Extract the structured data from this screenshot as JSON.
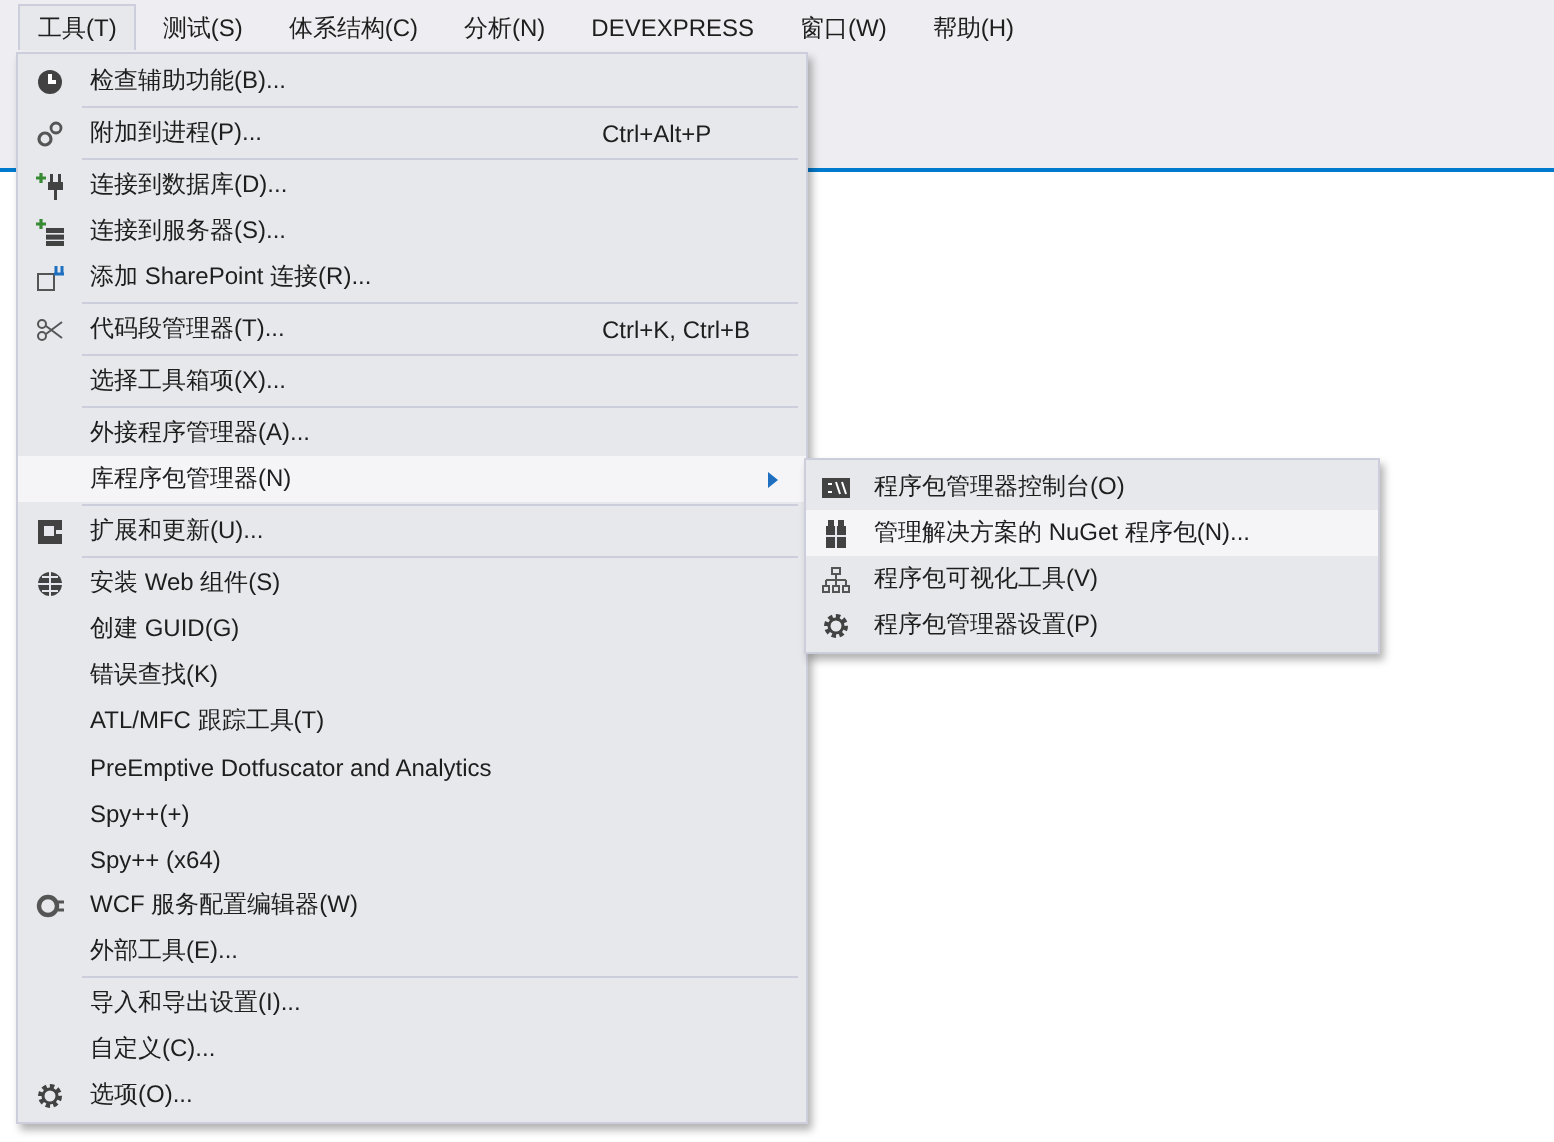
{
  "menu_bar": [
    {
      "label": "工具(T)",
      "selected": true
    },
    {
      "label": "测试(S)",
      "selected": false
    },
    {
      "label": "体系结构(C)",
      "selected": false
    },
    {
      "label": "分析(N)",
      "selected": false
    },
    {
      "label": "DEVEXPRESS",
      "selected": false
    },
    {
      "label": "窗口(W)",
      "selected": false
    },
    {
      "label": "帮助(H)",
      "selected": false
    }
  ],
  "tools_menu": {
    "groups": [
      [
        {
          "label": "检查辅助功能(B)...",
          "selected": false,
          "has_submenu": false
        }
      ],
      [
        {
          "label": "附加到进程(P)...",
          "shortcut": "Ctrl+Alt+P",
          "selected": false,
          "has_submenu": false
        }
      ],
      [
        {
          "label": "连接到数据库(D)...",
          "selected": false,
          "has_submenu": false
        },
        {
          "label": "连接到服务器(S)...",
          "selected": false,
          "has_submenu": false
        },
        {
          "label": "添加 SharePoint 连接(R)...",
          "selected": false,
          "has_submenu": false
        }
      ],
      [
        {
          "label": "代码段管理器(T)...",
          "shortcut": "Ctrl+K, Ctrl+B",
          "selected": false,
          "has_submenu": false
        }
      ],
      [
        {
          "label": "选择工具箱项(X)...",
          "selected": false,
          "has_submenu": false
        }
      ],
      [
        {
          "label": "外接程序管理器(A)...",
          "selected": false,
          "has_submenu": false
        },
        {
          "label": "库程序包管理器(N)",
          "selected": true,
          "has_submenu": true
        }
      ],
      [
        {
          "label": "扩展和更新(U)...",
          "selected": false,
          "has_submenu": false
        }
      ],
      [
        {
          "label": "安装 Web 组件(S)",
          "selected": false,
          "has_submenu": false
        },
        {
          "label": "创建 GUID(G)",
          "selected": false,
          "has_submenu": false
        },
        {
          "label": "错误查找(K)",
          "selected": false,
          "has_submenu": false
        },
        {
          "label": "ATL/MFC 跟踪工具(T)",
          "selected": false,
          "has_submenu": false
        },
        {
          "label": "PreEmptive Dotfuscator and Analytics",
          "selected": false,
          "has_submenu": false
        },
        {
          "label": "Spy++(+)",
          "selected": false,
          "has_submenu": false
        },
        {
          "label": "Spy++ (x64)",
          "selected": false,
          "has_submenu": false
        },
        {
          "label": "WCF 服务配置编辑器(W)",
          "selected": false,
          "has_submenu": false
        },
        {
          "label": "外部工具(E)...",
          "selected": false,
          "has_submenu": false
        }
      ],
      [
        {
          "label": "导入和导出设置(I)...",
          "selected": false,
          "has_submenu": false
        },
        {
          "label": "自定义(C)...",
          "selected": false,
          "has_submenu": false
        },
        {
          "label": "选项(O)...",
          "selected": false,
          "has_submenu": false
        }
      ]
    ]
  },
  "package_submenu": [
    {
      "label": "程序包管理器控制台(O)",
      "selected": false
    },
    {
      "label": "管理解决方案的 NuGet 程序包(N)...",
      "selected": true
    },
    {
      "label": "程序包可视化工具(V)",
      "selected": false
    },
    {
      "label": "程序包管理器设置(P)",
      "selected": false
    }
  ]
}
